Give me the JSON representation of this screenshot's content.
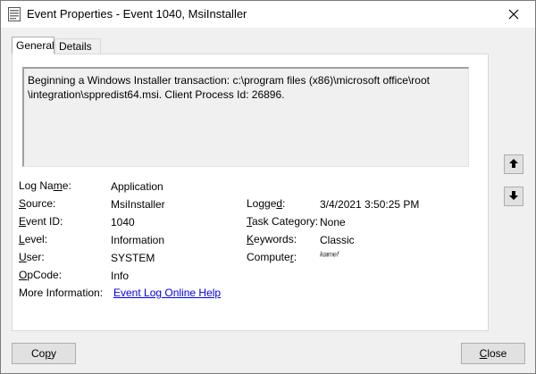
{
  "window": {
    "title": "Event Properties - Event 1040, MsiInstaller"
  },
  "tabs": [
    {
      "label": "General",
      "active": true
    },
    {
      "label": "Details",
      "active": false
    }
  ],
  "description": {
    "line1": "Beginning a Windows Installer transaction: c:\\program files (x86)\\microsoft office\\root",
    "line2": "\\integration\\sppredist64.msi. Client Process Id: 26896."
  },
  "fields": {
    "log_name": {
      "label_pre": "Log Na",
      "label_mn": "m",
      "label_post": "e:",
      "value": "Application"
    },
    "source": {
      "label_pre": "",
      "label_mn": "S",
      "label_post": "ource:",
      "value": "MsiInstaller"
    },
    "event_id": {
      "label_pre": "",
      "label_mn": "E",
      "label_post": "vent ID:",
      "value": "1040"
    },
    "level": {
      "label_pre": "",
      "label_mn": "L",
      "label_post": "evel:",
      "value": "Information"
    },
    "user": {
      "label_pre": "",
      "label_mn": "U",
      "label_post": "ser:",
      "value": "SYSTEM"
    },
    "opcode": {
      "label_pre": "",
      "label_mn": "O",
      "label_post": "pCode:",
      "value": "Info"
    },
    "more_info": {
      "label": "More Information:",
      "link": "Event Log Online Help"
    },
    "logged": {
      "label_pre": "Logge",
      "label_mn": "d",
      "label_post": ":",
      "value": "3/4/2021 3:50:25 PM"
    },
    "task_category": {
      "label_pre": "",
      "label_mn": "T",
      "label_post": "ask Category:",
      "value": "None"
    },
    "keywords": {
      "label_pre": "",
      "label_mn": "K",
      "label_post": "eywords:",
      "value": "Classic"
    },
    "computer": {
      "label_pre": "Compute",
      "label_mn": "r",
      "label_post": ":",
      "value": "ᵏᵃᶦᵐᵉᶠ"
    }
  },
  "buttons": {
    "copy": {
      "pre": "Co",
      "mn": "p",
      "post": "y"
    },
    "close": {
      "pre": "",
      "mn": "C",
      "post": "lose"
    }
  },
  "icons": {
    "window_icon": "event-viewer-icon",
    "close": "close-icon",
    "up": "arrow-up-icon",
    "down": "arrow-down-icon"
  }
}
